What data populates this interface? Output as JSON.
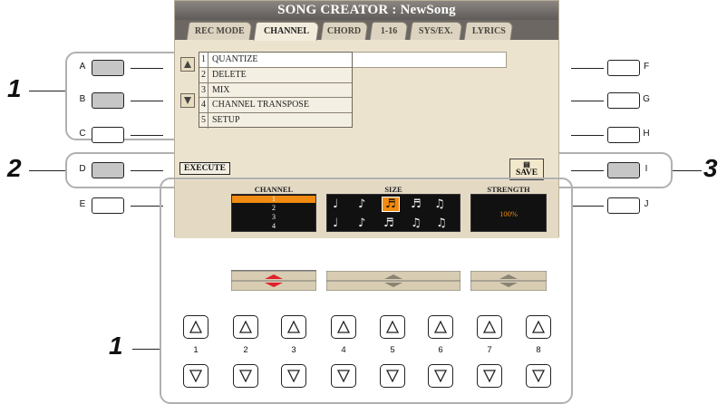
{
  "screen": {
    "title": "SONG CREATOR : NewSong",
    "tabs": [
      {
        "label": "REC MODE",
        "active": false
      },
      {
        "label": "CHANNEL",
        "active": true
      },
      {
        "label": "CHORD",
        "active": false
      },
      {
        "label": "1-16",
        "active": false
      },
      {
        "label": "SYS/EX.",
        "active": false
      },
      {
        "label": "LYRICS",
        "active": false
      }
    ],
    "menu": [
      {
        "num": "1",
        "label": "QUANTIZE",
        "selected": true
      },
      {
        "num": "2",
        "label": "DELETE"
      },
      {
        "num": "3",
        "label": "MIX"
      },
      {
        "num": "4",
        "label": "CHANNEL TRANSPOSE"
      },
      {
        "num": "5",
        "label": "SETUP"
      }
    ],
    "execute_label": "EXECUTE",
    "save_label": "SAVE",
    "save_icon": "disk-icon",
    "panel": {
      "channel_label": "CHANNEL",
      "channel_items": [
        "1",
        "2",
        "3",
        "4"
      ],
      "channel_selected": "1",
      "size_label": "SIZE",
      "size_notes_row1": [
        "quarter-note-icon",
        "eighth-note-icon",
        "sixteenth-note-icon",
        "thirtysecond-note-icon",
        "sixteenth-plus-triplet-icon"
      ],
      "size_notes_row2": [
        "quarter-triplet-icon",
        "eighth-triplet-icon",
        "sixteenth-triplet-icon",
        "eighth-plus-sixteenth-triplet-icon",
        "sixteenth-plus-thirtysecond-triplet-icon"
      ],
      "size_selected_index": 2,
      "strength_label": "STRENGTH",
      "strength_value": "100%"
    }
  },
  "side_buttons": {
    "left": [
      "A",
      "B",
      "C",
      "D",
      "E"
    ],
    "right": [
      "F",
      "G",
      "H",
      "I",
      "J"
    ],
    "highlighted": [
      "A",
      "B",
      "D",
      "I"
    ]
  },
  "bottom_buttons": [
    "1",
    "2",
    "3",
    "4",
    "5",
    "6",
    "7",
    "8"
  ],
  "callouts": {
    "menu_select": "1",
    "execute": "2",
    "save": "3",
    "bottom_buttons": "1"
  },
  "colors": {
    "selection": "#f08a10",
    "arrow_red": "#e0202a",
    "screen_bg": "#ece3cf",
    "title_bar": "#6c6763"
  }
}
